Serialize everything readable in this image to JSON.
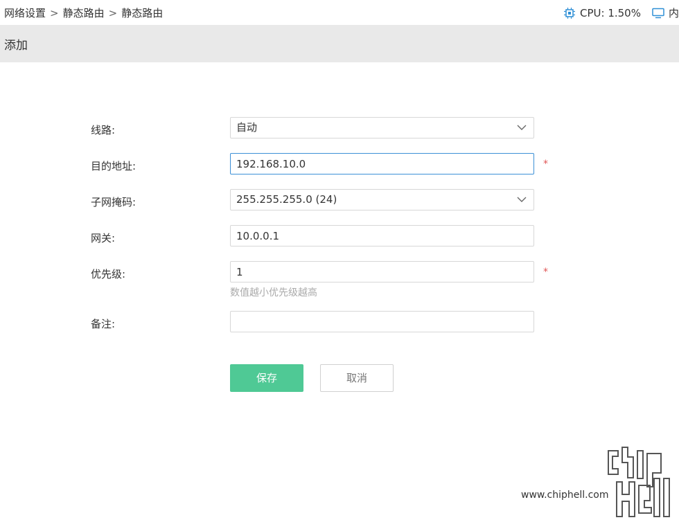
{
  "breadcrumb": {
    "items": [
      "网络设置",
      "静态路由",
      "静态路由"
    ],
    "separator": ">"
  },
  "status": {
    "cpu_label": "CPU: 1.50%",
    "mem_label": "内"
  },
  "section": {
    "title": "添加"
  },
  "form": {
    "line": {
      "label": "线路:",
      "value": "自动"
    },
    "dest": {
      "label": "目的地址:",
      "value": "192.168.10.0",
      "required": "*"
    },
    "mask": {
      "label": "子网掩码:",
      "value": "255.255.255.0 (24)"
    },
    "gateway": {
      "label": "网关:",
      "value": "10.0.0.1"
    },
    "priority": {
      "label": "优先级:",
      "value": "1",
      "required": "*",
      "hint": "数值越小优先级越高"
    },
    "note": {
      "label": "备注:",
      "value": ""
    }
  },
  "buttons": {
    "save": "保存",
    "cancel": "取消"
  },
  "colors": {
    "accent": "#4fc995",
    "focus": "#3b8fd6",
    "required": "#e05555",
    "header_bg": "#e9e9e9",
    "icon": "#2e8fd6"
  },
  "watermark": {
    "url": "www.chiphell.com",
    "logo_text": "chip hell"
  }
}
